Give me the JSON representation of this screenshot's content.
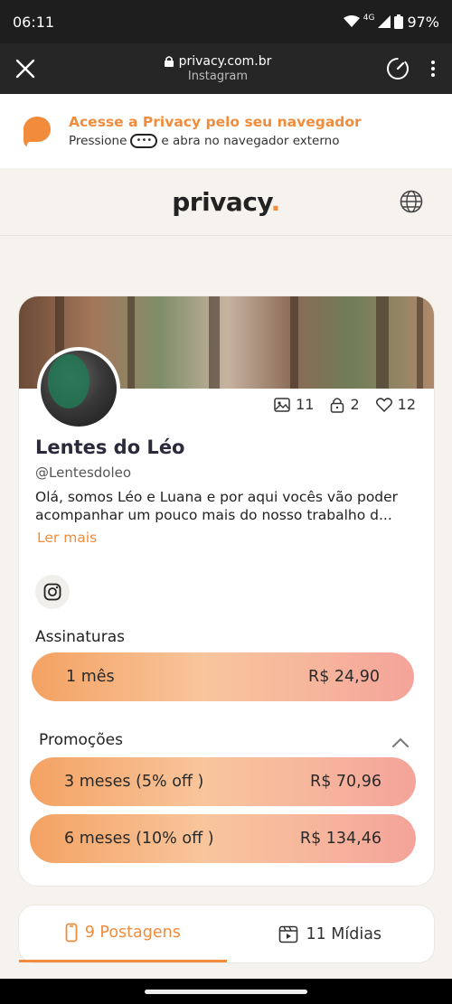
{
  "status": {
    "time": "06:11",
    "network": "4G",
    "battery": "97%"
  },
  "browser": {
    "url": "privacy.com.br",
    "subtitle": "Instagram"
  },
  "banner": {
    "title": "Acesse a Privacy pelo seu navegador",
    "press": "Pressione",
    "dots": "•••",
    "rest": "e abra no navegador externo"
  },
  "header": {
    "logo_text": "privacy",
    "logo_dot": "."
  },
  "profile": {
    "name": "Lentes do Léo",
    "handle": "@Lentesdoleo",
    "bio": "Olá, somos Léo e Luana e por aqui vocês vão poder acompanhar um pouco mais do nosso trabalho d...",
    "read_more": "Ler mais",
    "stats": {
      "images": "11",
      "locked": "2",
      "likes": "12"
    }
  },
  "subscriptions": {
    "title": "Assinaturas",
    "items": [
      {
        "label": "1 mês",
        "price": "R$ 24,90"
      }
    ]
  },
  "promotions": {
    "title": "Promoções",
    "items": [
      {
        "label": "3 meses (5% off )",
        "price": "R$ 70,96"
      },
      {
        "label": "6 meses (10% off )",
        "price": "R$ 134,46"
      }
    ]
  },
  "tabs": [
    {
      "label": "9 Postagens",
      "icon": "phone-icon"
    },
    {
      "label": "11 Mídias",
      "icon": "video-icon"
    }
  ],
  "colors": {
    "accent": "#f08c3c"
  }
}
